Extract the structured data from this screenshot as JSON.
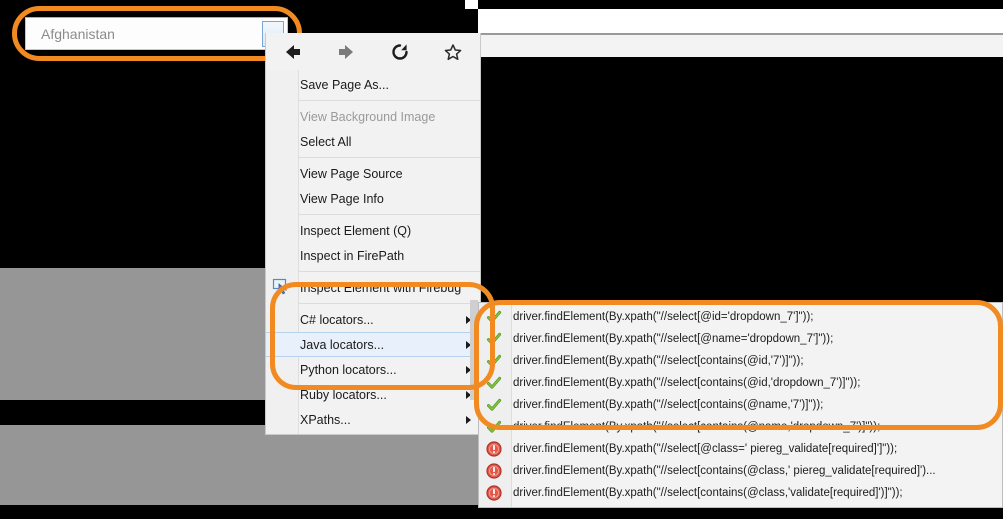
{
  "dropdown": {
    "name": "country-dropdown",
    "value": "Afghanistan",
    "arrow_icon": "chevron-down-icon",
    "highlight_color": "#f18a21"
  },
  "toolbar": {
    "buttons": [
      {
        "name": "back-button",
        "icon": "arrow-left-icon",
        "enabled": true
      },
      {
        "name": "forward-button",
        "icon": "arrow-right-icon",
        "enabled": false
      },
      {
        "name": "reload-button",
        "icon": "reload-icon",
        "enabled": true
      },
      {
        "name": "bookmark-button",
        "icon": "star-icon",
        "enabled": true
      }
    ]
  },
  "context_menu": {
    "items": [
      {
        "label": "Save Page As...",
        "accel": "P",
        "disabled": false,
        "submenu": false,
        "icon": null
      },
      {
        "separator": true
      },
      {
        "label": "View Background Image",
        "accel": "w",
        "disabled": true,
        "submenu": false,
        "icon": null
      },
      {
        "label": "Select All",
        "accel": "A",
        "disabled": false,
        "submenu": false,
        "icon": null
      },
      {
        "separator": true
      },
      {
        "label": "View Page Source",
        "accel": "V",
        "disabled": false,
        "submenu": false,
        "icon": null
      },
      {
        "label": "View Page Info",
        "accel": "I",
        "disabled": false,
        "submenu": false,
        "icon": null
      },
      {
        "separator": true
      },
      {
        "label": "Inspect Element (Q)",
        "disabled": false,
        "submenu": false,
        "icon": null
      },
      {
        "label": "Inspect in FirePath",
        "accel": "F",
        "disabled": false,
        "submenu": false,
        "icon": null
      },
      {
        "separator": true
      },
      {
        "label": "Inspect Element with Firebug",
        "disabled": false,
        "submenu": false,
        "icon": "firebug-icon"
      },
      {
        "separator": true
      },
      {
        "label": "C# locators...",
        "disabled": false,
        "submenu": true,
        "icon": null
      },
      {
        "label": "Java locators...",
        "disabled": false,
        "submenu": true,
        "selected": true,
        "icon": null
      },
      {
        "label": "Python locators...",
        "disabled": false,
        "submenu": true,
        "icon": null
      },
      {
        "label": "Ruby locators...",
        "disabled": false,
        "submenu": true,
        "icon": null
      },
      {
        "label": "XPaths...",
        "disabled": false,
        "submenu": true,
        "icon": null
      }
    ]
  },
  "submenu": {
    "title": "Java locators",
    "items": [
      {
        "status": "valid",
        "icon": "check-icon",
        "code": "driver.findElement(By.xpath(\"//select[@id='dropdown_7']\"));"
      },
      {
        "status": "valid",
        "icon": "check-icon",
        "code": "driver.findElement(By.xpath(\"//select[@name='dropdown_7']\"));"
      },
      {
        "status": "valid",
        "icon": "check-icon",
        "code": "driver.findElement(By.xpath(\"//select[contains(@id,'7')]\"));"
      },
      {
        "status": "valid",
        "icon": "check-icon",
        "code": "driver.findElement(By.xpath(\"//select[contains(@id,'dropdown_7')]\"));"
      },
      {
        "status": "valid",
        "icon": "check-icon",
        "code": "driver.findElement(By.xpath(\"//select[contains(@name,'7')]\"));"
      },
      {
        "status": "valid",
        "icon": "check-icon",
        "code": "driver.findElement(By.xpath(\"//select[contains(@name,'dropdown_7')]\"));"
      },
      {
        "status": "error",
        "icon": "error-icon",
        "code": "driver.findElement(By.xpath(\"//select[@class=' piereg_validate[required]']\"));"
      },
      {
        "status": "error",
        "icon": "error-icon",
        "code": "driver.findElement(By.xpath(\"//select[contains(@class,' piereg_validate[required]')..."
      },
      {
        "status": "error",
        "icon": "error-icon",
        "code": "driver.findElement(By.xpath(\"//select[contains(@class,'validate[required]')]\"));"
      }
    ]
  },
  "colors": {
    "highlight": "#f18a21",
    "valid": "#5ca02c",
    "error": "#d9483c",
    "menu_bg": "#f2f2f2",
    "selected_bg": "#e8f1fb"
  }
}
